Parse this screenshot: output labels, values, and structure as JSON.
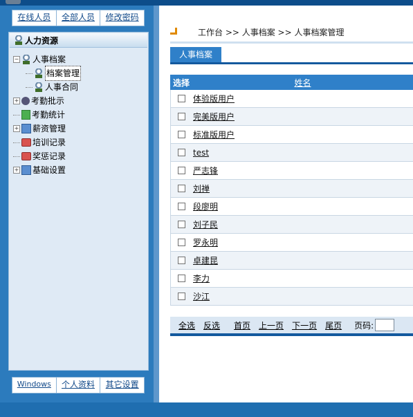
{
  "top_links": [
    "在线人员",
    "全部人员",
    "修改密码"
  ],
  "tree": {
    "title": "人力资源",
    "nodes": [
      {
        "label": "人事档案"
      },
      {
        "label": "档案管理"
      },
      {
        "label": "人事合同"
      },
      {
        "label": "考勤批示"
      },
      {
        "label": "考勤统计"
      },
      {
        "label": "薪资管理"
      },
      {
        "label": "培训记录"
      },
      {
        "label": "奖惩记录"
      },
      {
        "label": "基础设置"
      }
    ]
  },
  "bottom_links": [
    "Windows",
    "个人资料",
    "其它设置"
  ],
  "breadcrumb": "工作台 >> 人事档案 >> 人事档案管理",
  "tab": "人事档案",
  "table": {
    "col_select": "选择",
    "col_name": "姓名",
    "rows": [
      "体验版用户",
      "完美版用户",
      "标准版用户",
      "test",
      "严志锋",
      "刘禅",
      "段廖明",
      "刘子民",
      "罗永明",
      "卓建昆",
      "李力",
      "沙江"
    ]
  },
  "pager": {
    "select_all": "全选",
    "invert": "反选",
    "first": "首页",
    "prev": "上一页",
    "next": "下一页",
    "last": "尾页",
    "page_label": "页码:"
  },
  "colors": {
    "frame": "#1f6eb0",
    "accent": "#2f80c9",
    "tree_bg": "#dfeaf5"
  }
}
